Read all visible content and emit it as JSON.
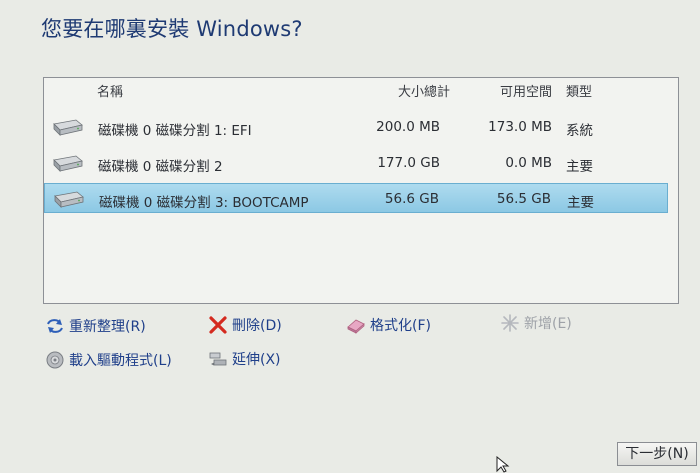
{
  "title": "您要在哪裏安裝 Windows?",
  "table": {
    "headers": {
      "name": "名稱",
      "size": "大小總計",
      "free": "可用空間",
      "type": "類型"
    },
    "rows": [
      {
        "name": "磁碟機 0 磁碟分割 1: EFI",
        "size": "200.0 MB",
        "free": "173.0 MB",
        "type": "系統",
        "selected": false
      },
      {
        "name": "磁碟機 0 磁碟分割 2",
        "size": "177.0 GB",
        "free": "0.0 MB",
        "type": "主要",
        "selected": false
      },
      {
        "name": "磁碟機 0 磁碟分割 3: BOOTCAMP",
        "size": "56.6 GB",
        "free": "56.5 GB",
        "type": "主要",
        "selected": true
      }
    ]
  },
  "actions": {
    "refresh": "重新整理(R)",
    "delete": "刪除(D)",
    "format": "格式化(F)",
    "new": "新增(E)",
    "load_driver": "載入驅動程式(L)",
    "extend": "延伸(X)"
  },
  "next_button": "下一步(N)",
  "colors": {
    "title": "#1e3a73",
    "link": "#1f3f8a",
    "selection": "#8cc8e4",
    "disabled": "#9ea2a8"
  },
  "icons": {
    "disk": "hard-disk-icon",
    "refresh": "refresh-icon",
    "delete": "delete-icon",
    "format": "eraser-icon",
    "new": "sparkle-icon",
    "load_driver": "cd-icon",
    "extend": "extend-icon"
  }
}
